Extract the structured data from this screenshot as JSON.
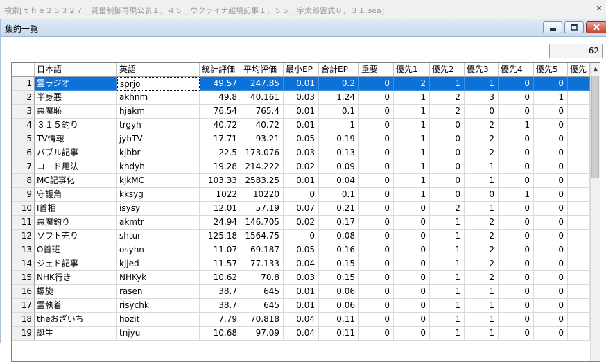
{
  "search": {
    "text": "検索[ｔｈｅ２５３２７__質量制御再現公表１，４５__ウクライナ越境記事１，５５__宇太郎霊式０，３１.sea]",
    "close_symbol": "✕"
  },
  "window": {
    "title": "集約一覧",
    "min_label": "minimize",
    "max_label": "maximize",
    "close_label": "close"
  },
  "count": "62",
  "scrollbar": {
    "up_symbol": "▲"
  },
  "colors": {
    "selection": "#0a72d8",
    "header_bg": "#ffffff",
    "rownum_bg": "#f0f0f0"
  },
  "table": {
    "columns": [
      "",
      "日本語",
      "英語",
      "統計評価",
      "平均評価",
      "最小EP",
      "合計EP",
      "重要",
      "優先1",
      "優先2",
      "優先3",
      "優先4",
      "優先5",
      "優先"
    ],
    "selected_row": 0,
    "rows": [
      [
        "1",
        "霊ラジオ",
        "sprjo",
        "49.57",
        "247.85",
        "0.01",
        "0.2",
        "0",
        "2",
        "1",
        "1",
        "0",
        "0"
      ],
      [
        "2",
        "半身悪",
        "akhnm",
        "49.8",
        "40.161",
        "0.03",
        "1.24",
        "0",
        "1",
        "2",
        "3",
        "0",
        "1"
      ],
      [
        "3",
        "悪魔恥",
        "hjakm",
        "76.54",
        "765.4",
        "0.01",
        "0.1",
        "0",
        "1",
        "2",
        "0",
        "0",
        "0"
      ],
      [
        "4",
        "３１５釣り",
        "trgyh",
        "40.72",
        "40.72",
        "0.01",
        "1",
        "0",
        "1",
        "0",
        "2",
        "1",
        "0"
      ],
      [
        "5",
        "TV情報",
        "jyhTV",
        "17.71",
        "93.21",
        "0.05",
        "0.19",
        "0",
        "1",
        "0",
        "2",
        "0",
        "0"
      ],
      [
        "6",
        "バブル記事",
        "kjbbr",
        "22.5",
        "173.076",
        "0.03",
        "0.13",
        "0",
        "1",
        "0",
        "2",
        "0",
        "0"
      ],
      [
        "7",
        "コード用法",
        "khdyh",
        "19.28",
        "214.222",
        "0.02",
        "0.09",
        "0",
        "1",
        "0",
        "1",
        "0",
        "0"
      ],
      [
        "8",
        "MC記事化",
        "kjkMC",
        "103.33",
        "2583.25",
        "0.01",
        "0.04",
        "0",
        "1",
        "0",
        "1",
        "0",
        "0"
      ],
      [
        "9",
        "守護角",
        "kksyg",
        "1022",
        "10220",
        "0",
        "0.1",
        "0",
        "1",
        "0",
        "0",
        "1",
        "0"
      ],
      [
        "10",
        "I首相",
        "isysy",
        "12.01",
        "57.19",
        "0.07",
        "0.21",
        "0",
        "0",
        "2",
        "1",
        "0",
        "0"
      ],
      [
        "11",
        "悪魔釣り",
        "akmtr",
        "24.94",
        "146.705",
        "0.02",
        "0.17",
        "0",
        "0",
        "1",
        "2",
        "0",
        "0"
      ],
      [
        "12",
        "ソフト売り",
        "shtur",
        "125.18",
        "1564.75",
        "0",
        "0.08",
        "0",
        "0",
        "1",
        "2",
        "0",
        "0"
      ],
      [
        "13",
        "O首班",
        "osyhn",
        "11.07",
        "69.187",
        "0.05",
        "0.16",
        "0",
        "0",
        "1",
        "2",
        "0",
        "0"
      ],
      [
        "14",
        "ジェド記事",
        "kjjed",
        "11.57",
        "77.133",
        "0.04",
        "0.15",
        "0",
        "0",
        "1",
        "2",
        "0",
        "0"
      ],
      [
        "15",
        "NHK行き",
        "NHKyk",
        "10.62",
        "70.8",
        "0.03",
        "0.15",
        "0",
        "0",
        "1",
        "2",
        "0",
        "0"
      ],
      [
        "16",
        "螺旋",
        "rasen",
        "38.7",
        "645",
        "0.01",
        "0.06",
        "0",
        "0",
        "1",
        "1",
        "0",
        "0"
      ],
      [
        "17",
        "霊執着",
        "risychk",
        "38.7",
        "645",
        "0.01",
        "0.06",
        "0",
        "0",
        "1",
        "1",
        "0",
        "0"
      ],
      [
        "18",
        "theおざいち",
        "hozit",
        "7.79",
        "70.818",
        "0.04",
        "0.11",
        "0",
        "0",
        "1",
        "1",
        "0",
        "0"
      ],
      [
        "19",
        "誕生",
        "tnjyu",
        "10.68",
        "97.09",
        "0.04",
        "0.11",
        "0",
        "0",
        "1",
        "1",
        "0",
        "0"
      ]
    ]
  }
}
